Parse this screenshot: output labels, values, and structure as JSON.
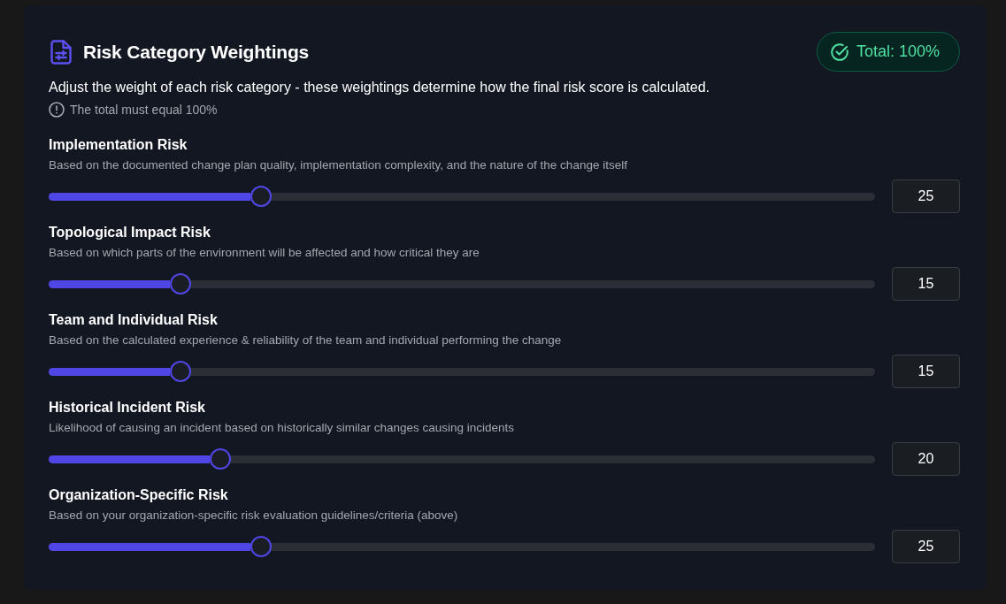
{
  "header": {
    "title": "Risk Category Weightings",
    "total_badge": "Total: 100%"
  },
  "description": "Adjust the weight of each risk category - these weightings determine how the final risk score is calculated.",
  "note": "The total must equal 100%",
  "categories": [
    {
      "name": "Implementation Risk",
      "description": "Based on the documented change plan quality, implementation complexity, and the nature of the change itself",
      "level": 0.25,
      "value": "25"
    },
    {
      "name": "Topological Impact Risk",
      "description": "Based on which parts of the environment will be affected and how critical they are",
      "level": 0.15,
      "value": "15"
    },
    {
      "name": "Team and Individual Risk",
      "description": "Based on the calculated experience & reliability of the team and individual performing the change",
      "level": 0.15,
      "value": "15"
    },
    {
      "name": "Historical Incident Risk",
      "description": "Likelihood of causing an incident based on historically similar changes causing incidents",
      "level": 0.2,
      "value": "20"
    },
    {
      "name": "Organization-Specific Risk",
      "description": "Based on your organization-specific risk evaluation guidelines/criteria (above)",
      "level": 0.25,
      "value": "25"
    }
  ]
}
